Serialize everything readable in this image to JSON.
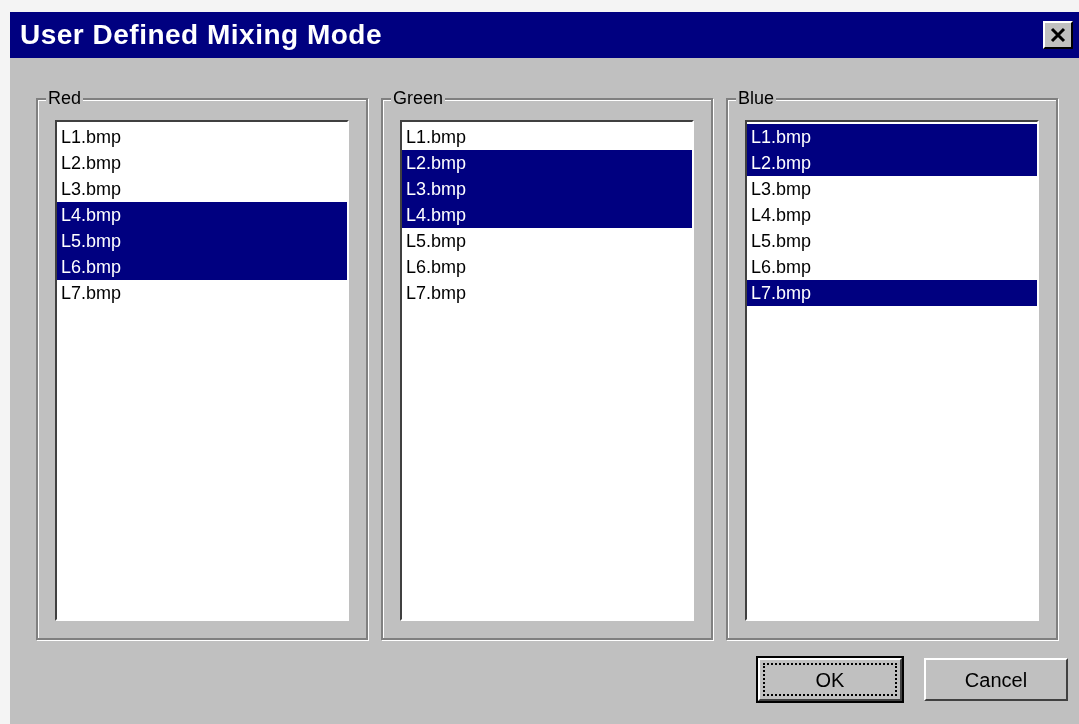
{
  "window": {
    "title": "User Defined Mixing Mode"
  },
  "groups": [
    {
      "label": "Red",
      "items": [
        {
          "text": "L1.bmp",
          "selected": false
        },
        {
          "text": "L2.bmp",
          "selected": false
        },
        {
          "text": "L3.bmp",
          "selected": false
        },
        {
          "text": "L4.bmp",
          "selected": true
        },
        {
          "text": "L5.bmp",
          "selected": true
        },
        {
          "text": "L6.bmp",
          "selected": true
        },
        {
          "text": "L7.bmp",
          "selected": false
        }
      ]
    },
    {
      "label": "Green",
      "items": [
        {
          "text": "L1.bmp",
          "selected": false
        },
        {
          "text": "L2.bmp",
          "selected": true
        },
        {
          "text": "L3.bmp",
          "selected": true
        },
        {
          "text": "L4.bmp",
          "selected": true
        },
        {
          "text": "L5.bmp",
          "selected": false
        },
        {
          "text": "L6.bmp",
          "selected": false
        },
        {
          "text": "L7.bmp",
          "selected": false
        }
      ]
    },
    {
      "label": "Blue",
      "items": [
        {
          "text": "L1.bmp",
          "selected": true
        },
        {
          "text": "L2.bmp",
          "selected": true
        },
        {
          "text": "L3.bmp",
          "selected": false
        },
        {
          "text": "L4.bmp",
          "selected": false
        },
        {
          "text": "L5.bmp",
          "selected": false
        },
        {
          "text": "L6.bmp",
          "selected": false
        },
        {
          "text": "L7.bmp",
          "selected": true
        }
      ]
    }
  ],
  "buttons": [
    {
      "label": "OK",
      "default": true
    },
    {
      "label": "Cancel",
      "default": false
    }
  ]
}
